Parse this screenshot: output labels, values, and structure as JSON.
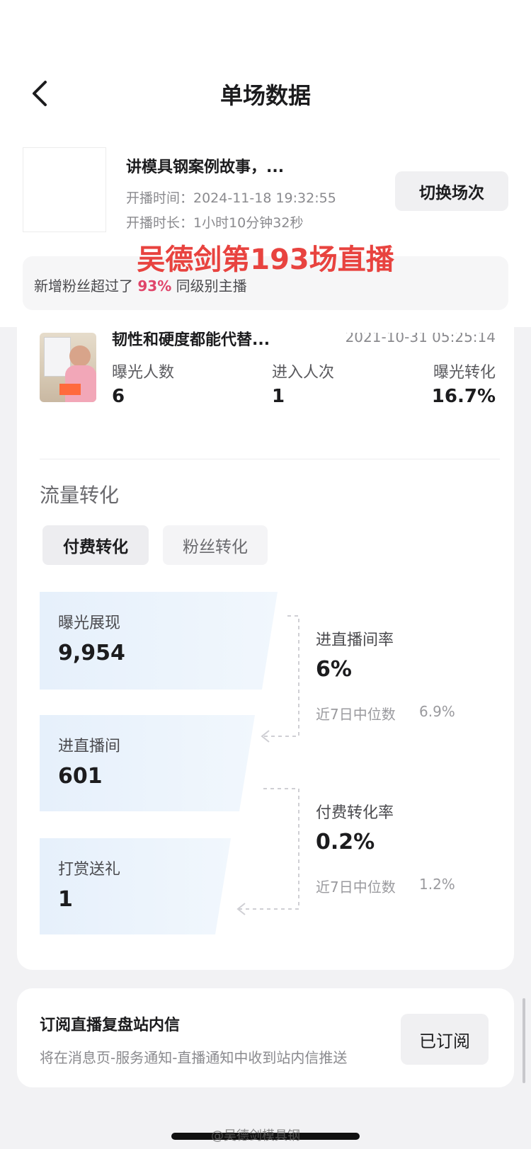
{
  "header": {
    "title": "单场数据",
    "back_icon": "chevron-left-icon"
  },
  "session": {
    "title": "讲模具钢案例故事，...",
    "start_time": "开播时间：2024-11-18 19:32:55",
    "duration": "开播时长：1小时10分钟32秒",
    "switch_label": "切换场次"
  },
  "overlay_caption": "吴德剑第193场直播",
  "fan_banner": {
    "prefix": "新增粉丝超过了",
    "percent": "93%",
    "suffix": "同级别主播"
  },
  "video": {
    "title": "韧性和硬度都能代替...",
    "date": "2021-10-31 05:25:14",
    "stats": [
      {
        "label": "曝光人数",
        "value": "6"
      },
      {
        "label": "进入人次",
        "value": "1"
      },
      {
        "label": "曝光转化",
        "value": "16.7%"
      }
    ]
  },
  "traffic": {
    "section_title": "流量转化",
    "tabs": [
      {
        "label": "付费转化",
        "active": true
      },
      {
        "label": "粉丝转化",
        "active": false
      }
    ],
    "funnel": [
      {
        "label": "曝光展现",
        "value": "9,954"
      },
      {
        "label": "进直播间",
        "value": "601"
      },
      {
        "label": "打赏送礼",
        "value": "1"
      }
    ],
    "rates": [
      {
        "label": "进直播间率",
        "value": "6%",
        "median_label": "近7日中位数",
        "median_value": "6.9%"
      },
      {
        "label": "付费转化率",
        "value": "0.2%",
        "median_label": "近7日中位数",
        "median_value": "1.2%"
      }
    ]
  },
  "subscription": {
    "title": "订阅直播复盘站内信",
    "description": "将在消息页-服务通知-直播通知中收到站内信推送",
    "button_label": "已订阅"
  },
  "watermark": "@吴德剑模具钢",
  "colors": {
    "accent_red": "#e8433f",
    "highlight_pink": "#e0456a",
    "funnel_blue": "#e9f3fc"
  }
}
